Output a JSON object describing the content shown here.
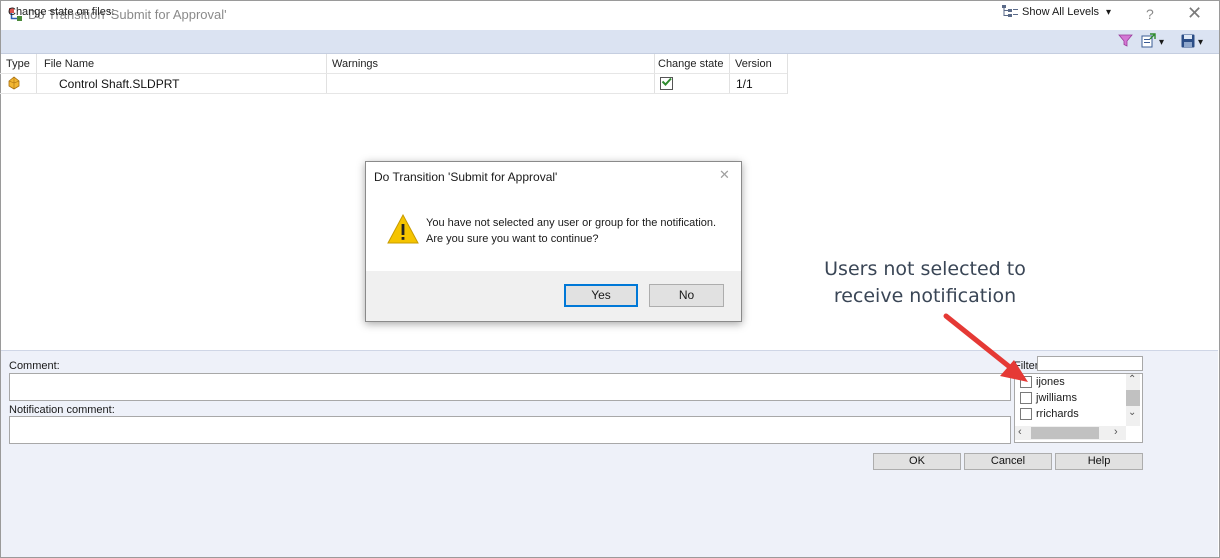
{
  "window": {
    "title": "Do Transition 'Submit for Approval'",
    "help": "?",
    "close": "✕"
  },
  "toolbar": {
    "label": "Change state on files:",
    "levels_label": "Show All Levels",
    "dropdown": "▾"
  },
  "grid": {
    "headers": [
      "Type",
      "File Name",
      "Warnings",
      "Change state",
      "Version"
    ],
    "row": {
      "file_name": "Control Shaft.SLDPRT",
      "warnings": "",
      "version": "1/1",
      "change_state": true
    }
  },
  "comment": {
    "label": "Comment:",
    "value": ""
  },
  "notification": {
    "label": "Notification comment:",
    "value": ""
  },
  "filter": {
    "label": "Filter",
    "value": ""
  },
  "users": [
    {
      "name": "ijones",
      "checked": false
    },
    {
      "name": "jwilliams",
      "checked": false
    },
    {
      "name": "rrichards",
      "checked": false
    }
  ],
  "buttons": {
    "ok": "OK",
    "cancel": "Cancel",
    "help": "Help"
  },
  "dialog": {
    "title": "Do Transition 'Submit for Approval'",
    "close": "✕",
    "message_line1": "You have not selected any user or group for the notification.",
    "message_line2": "Are you sure you want to continue?",
    "yes": "Yes",
    "no": "No"
  },
  "annotation": {
    "line1": "Users not selected to",
    "line2": "receive notification",
    "arrow_color": "#e53935"
  },
  "colors": {
    "toolbar_bg": "#dbe3f2",
    "lower_panel_bg": "#eef1f9",
    "warning_yellow": "#f5c400",
    "checkmark_green": "#2e8b2e"
  }
}
